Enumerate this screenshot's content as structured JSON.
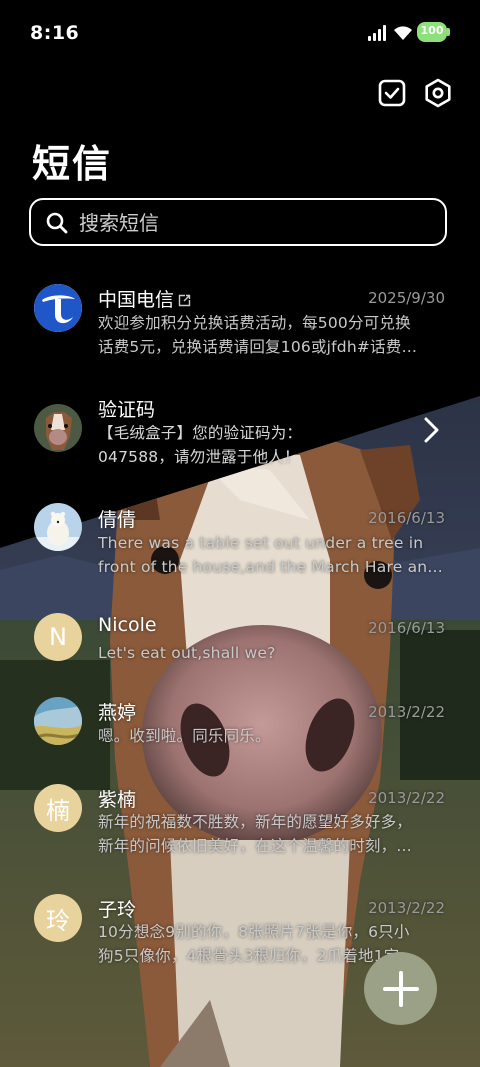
{
  "status_bar": {
    "time": "8:16",
    "battery_level": "100"
  },
  "header": {
    "title": "短信",
    "icons": [
      "select-check-icon",
      "settings-hex-icon"
    ]
  },
  "search": {
    "placeholder": "搜索短信"
  },
  "colors": {
    "background": "#000000",
    "battery": "#8ee07a",
    "letter_avatar": "#e8d39c",
    "fab": "#9aa186",
    "telecom_blue": "#1f56c8"
  },
  "messages": [
    {
      "name": "中国电信",
      "date": "2025/9/30",
      "line1": "欢迎参加积分兑换话费活动，每500分可兑换",
      "line2": "话费5元，兑换话费请回复106或jfdh#话费…",
      "avatar": "china-telecom-logo"
    },
    {
      "name": "验证码",
      "date": "",
      "line1": "【毛绒盒子】您的验证码为：",
      "line2": "047588，请勿泄露于他人！",
      "avatar": "horse-photo"
    },
    {
      "name": "倩倩",
      "date": "2016/6/13",
      "line1": "There was a table set out under a tree in",
      "line2": "front of the house,and the March Hare an…",
      "avatar": "polar-bear-photo"
    },
    {
      "name": "Nicole",
      "date": "2016/6/13",
      "line1": "Let's eat out,shall we?",
      "line2": "",
      "avatar_letter": "N"
    },
    {
      "name": "燕婷",
      "date": "2013/2/22",
      "line1": "嗯。收到啦。同乐同乐。",
      "line2": "",
      "avatar": "landscape-photo"
    },
    {
      "name": "紫楠",
      "date": "2013/2/22",
      "line1": "新年的祝福数不胜数，新年的愿望好多好多，",
      "line2": "新年的问候依旧美好，在这个温馨的时刻，…",
      "avatar_letter": "楠"
    },
    {
      "name": "子玲",
      "date": "2013/2/22",
      "line1": "10分想念9别的你，8张照片7张是你，6只小",
      "line2": "狗5只像你，4根骨头3根归你，2爪着地1定…",
      "avatar_letter": "玲"
    }
  ]
}
